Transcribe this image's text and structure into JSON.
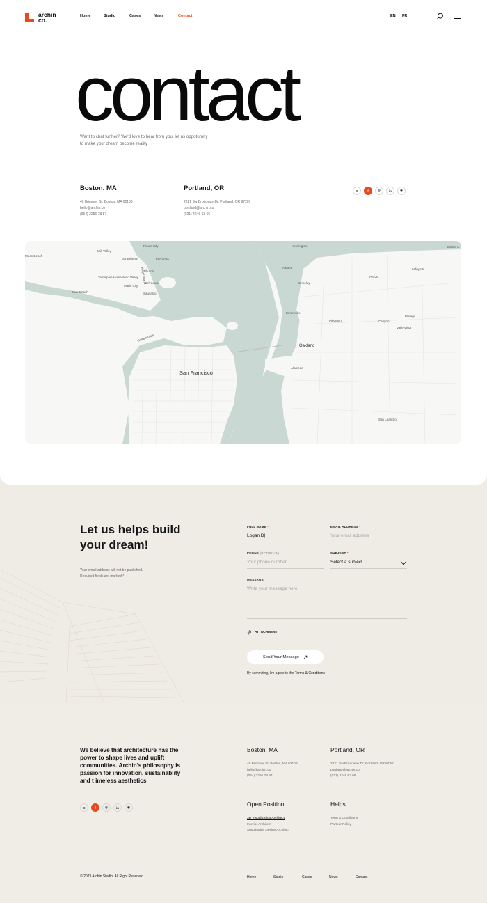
{
  "brand": {
    "name_line1": "archin",
    "name_line2": "co.",
    "accent": "#e8491d"
  },
  "nav": {
    "items": [
      "Home",
      "Studio",
      "Cases",
      "News",
      "Contact"
    ],
    "active": "Contact"
  },
  "lang": [
    "EN",
    "FR"
  ],
  "icons": {
    "search": "search-icon",
    "menu": "hamburger-menu-icon"
  },
  "hero": {
    "title": "contact",
    "subtitle_line1": "Want to chat further? We'd love to hear from you, let us oppoturnity",
    "subtitle_line2": "to make your dream become reality"
  },
  "offices": [
    {
      "city": "Boston, MA",
      "address": "49 Brimmer St, Boston, MA 02108",
      "email": "hello@archin.co",
      "phone": "(054) 3256 78 87"
    },
    {
      "city": "Portland, OR",
      "address": "2221 Sw Broadway Dr, Portland, OR 97201",
      "email": "portland@archin.co",
      "phone": "(021) 4246 63 66"
    }
  ],
  "socials": [
    "X",
    "f",
    "◎",
    "in",
    "◉"
  ],
  "map": {
    "labels": [
      "Mill Valley",
      "Sausalito",
      "Tiburon",
      "Belvedere",
      "El Cerrito",
      "Albany",
      "Berkeley",
      "Emeryville",
      "Piedmont",
      "Oakland",
      "Alameda",
      "San Francisco",
      "Orinda",
      "Moraga",
      "Canyon",
      "San Leandro",
      "Kensington",
      "Walnut C",
      "Lafayette",
      "Muir Beach",
      "Strawberry",
      "Golden Gate",
      "Marin City",
      "Valle Vista",
      "Tamalpais-Homestead Valley",
      "Angel Island",
      "Moon Beach",
      "Pinole City"
    ]
  },
  "form": {
    "title": "Let us helps build your dream!",
    "note_line1": "Your email address will not be published.",
    "note_line2": "Required fields are marked",
    "required_mark": "*",
    "full_name": {
      "label": "FULL NAME",
      "value": "Logan D|"
    },
    "email": {
      "label": "EMAIL ADDRESS",
      "placeholder": "Your email address"
    },
    "phone": {
      "label": "PHONE",
      "optional": "(OPTIONAL)",
      "placeholder": "Your phone number"
    },
    "subject": {
      "label": "SUBJECT",
      "value": "Select a subject"
    },
    "message": {
      "label": "MESSAGE",
      "placeholder": "Write your message here"
    },
    "attachment": "ATTACHMENT",
    "send": "Send Your Message",
    "agree_prefix": "By summiting, I'm agree to the",
    "agree_link": "Terms & Conditions"
  },
  "footer": {
    "mission": "We believe that architecture has the power to shape lives and uplift communities. Archin's philosophy is passion for innovation, sustainablity and t imeless aesthetics",
    "open_position": {
      "title": "Open Position",
      "items": [
        "3D Visualization Architect",
        "Interior Architect",
        "Sustainable Design Architect"
      ]
    },
    "helps": {
      "title": "Helps",
      "items": [
        "Term & Conditions",
        "Partner Policy"
      ]
    },
    "copyright": "© 2023 Archin Studio. All Right Reserved",
    "nav": [
      "Home",
      "Studio",
      "Cases",
      "News",
      "Contact"
    ]
  }
}
